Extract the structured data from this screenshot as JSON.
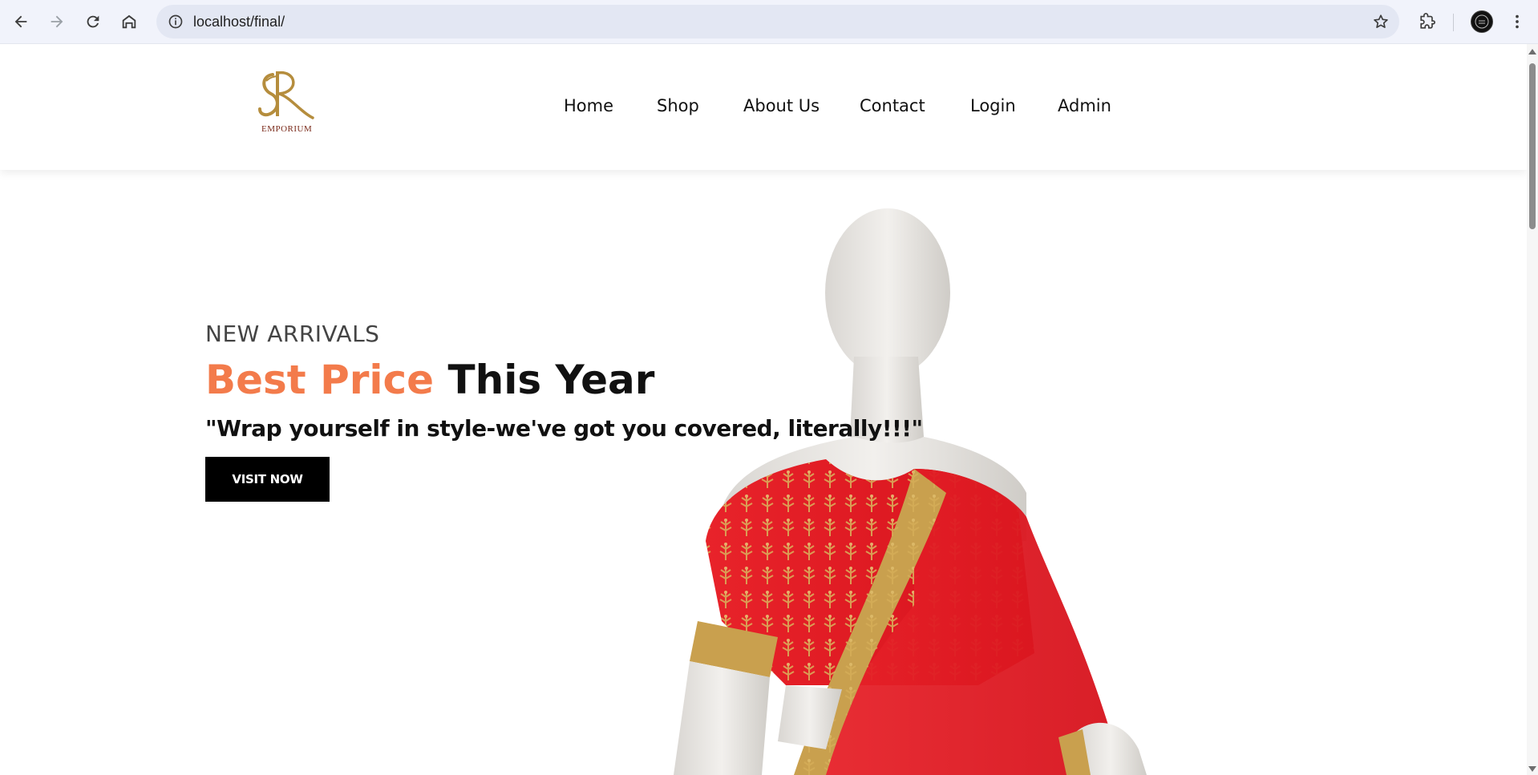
{
  "browser": {
    "url": "localhost/final/",
    "icons": {
      "back": "arrow-left-icon",
      "forward": "arrow-right-icon",
      "reload": "reload-icon",
      "home": "home-icon",
      "info": "info-icon",
      "bookmark": "star-icon",
      "extensions": "puzzle-icon",
      "menu": "kebab-menu-icon"
    }
  },
  "site": {
    "logo_text": "EMPORIUM",
    "nav": [
      {
        "label": "Home"
      },
      {
        "label": "Shop"
      },
      {
        "label": "About Us"
      },
      {
        "label": "Contact"
      },
      {
        "label": "Login"
      },
      {
        "label": "Admin"
      }
    ]
  },
  "hero": {
    "eyebrow": "NEW ARRIVALS",
    "headline_accent": "Best Price",
    "headline_rest": "This Year",
    "tagline": "\"Wrap yourself in style-we've got you covered, literally!!!\"",
    "cta": "VISIT NOW"
  },
  "colors": {
    "accent": "#f37b4b",
    "button_bg": "#000000",
    "logo_gold": "#b58d3d",
    "saree_red": "#e31b23"
  }
}
